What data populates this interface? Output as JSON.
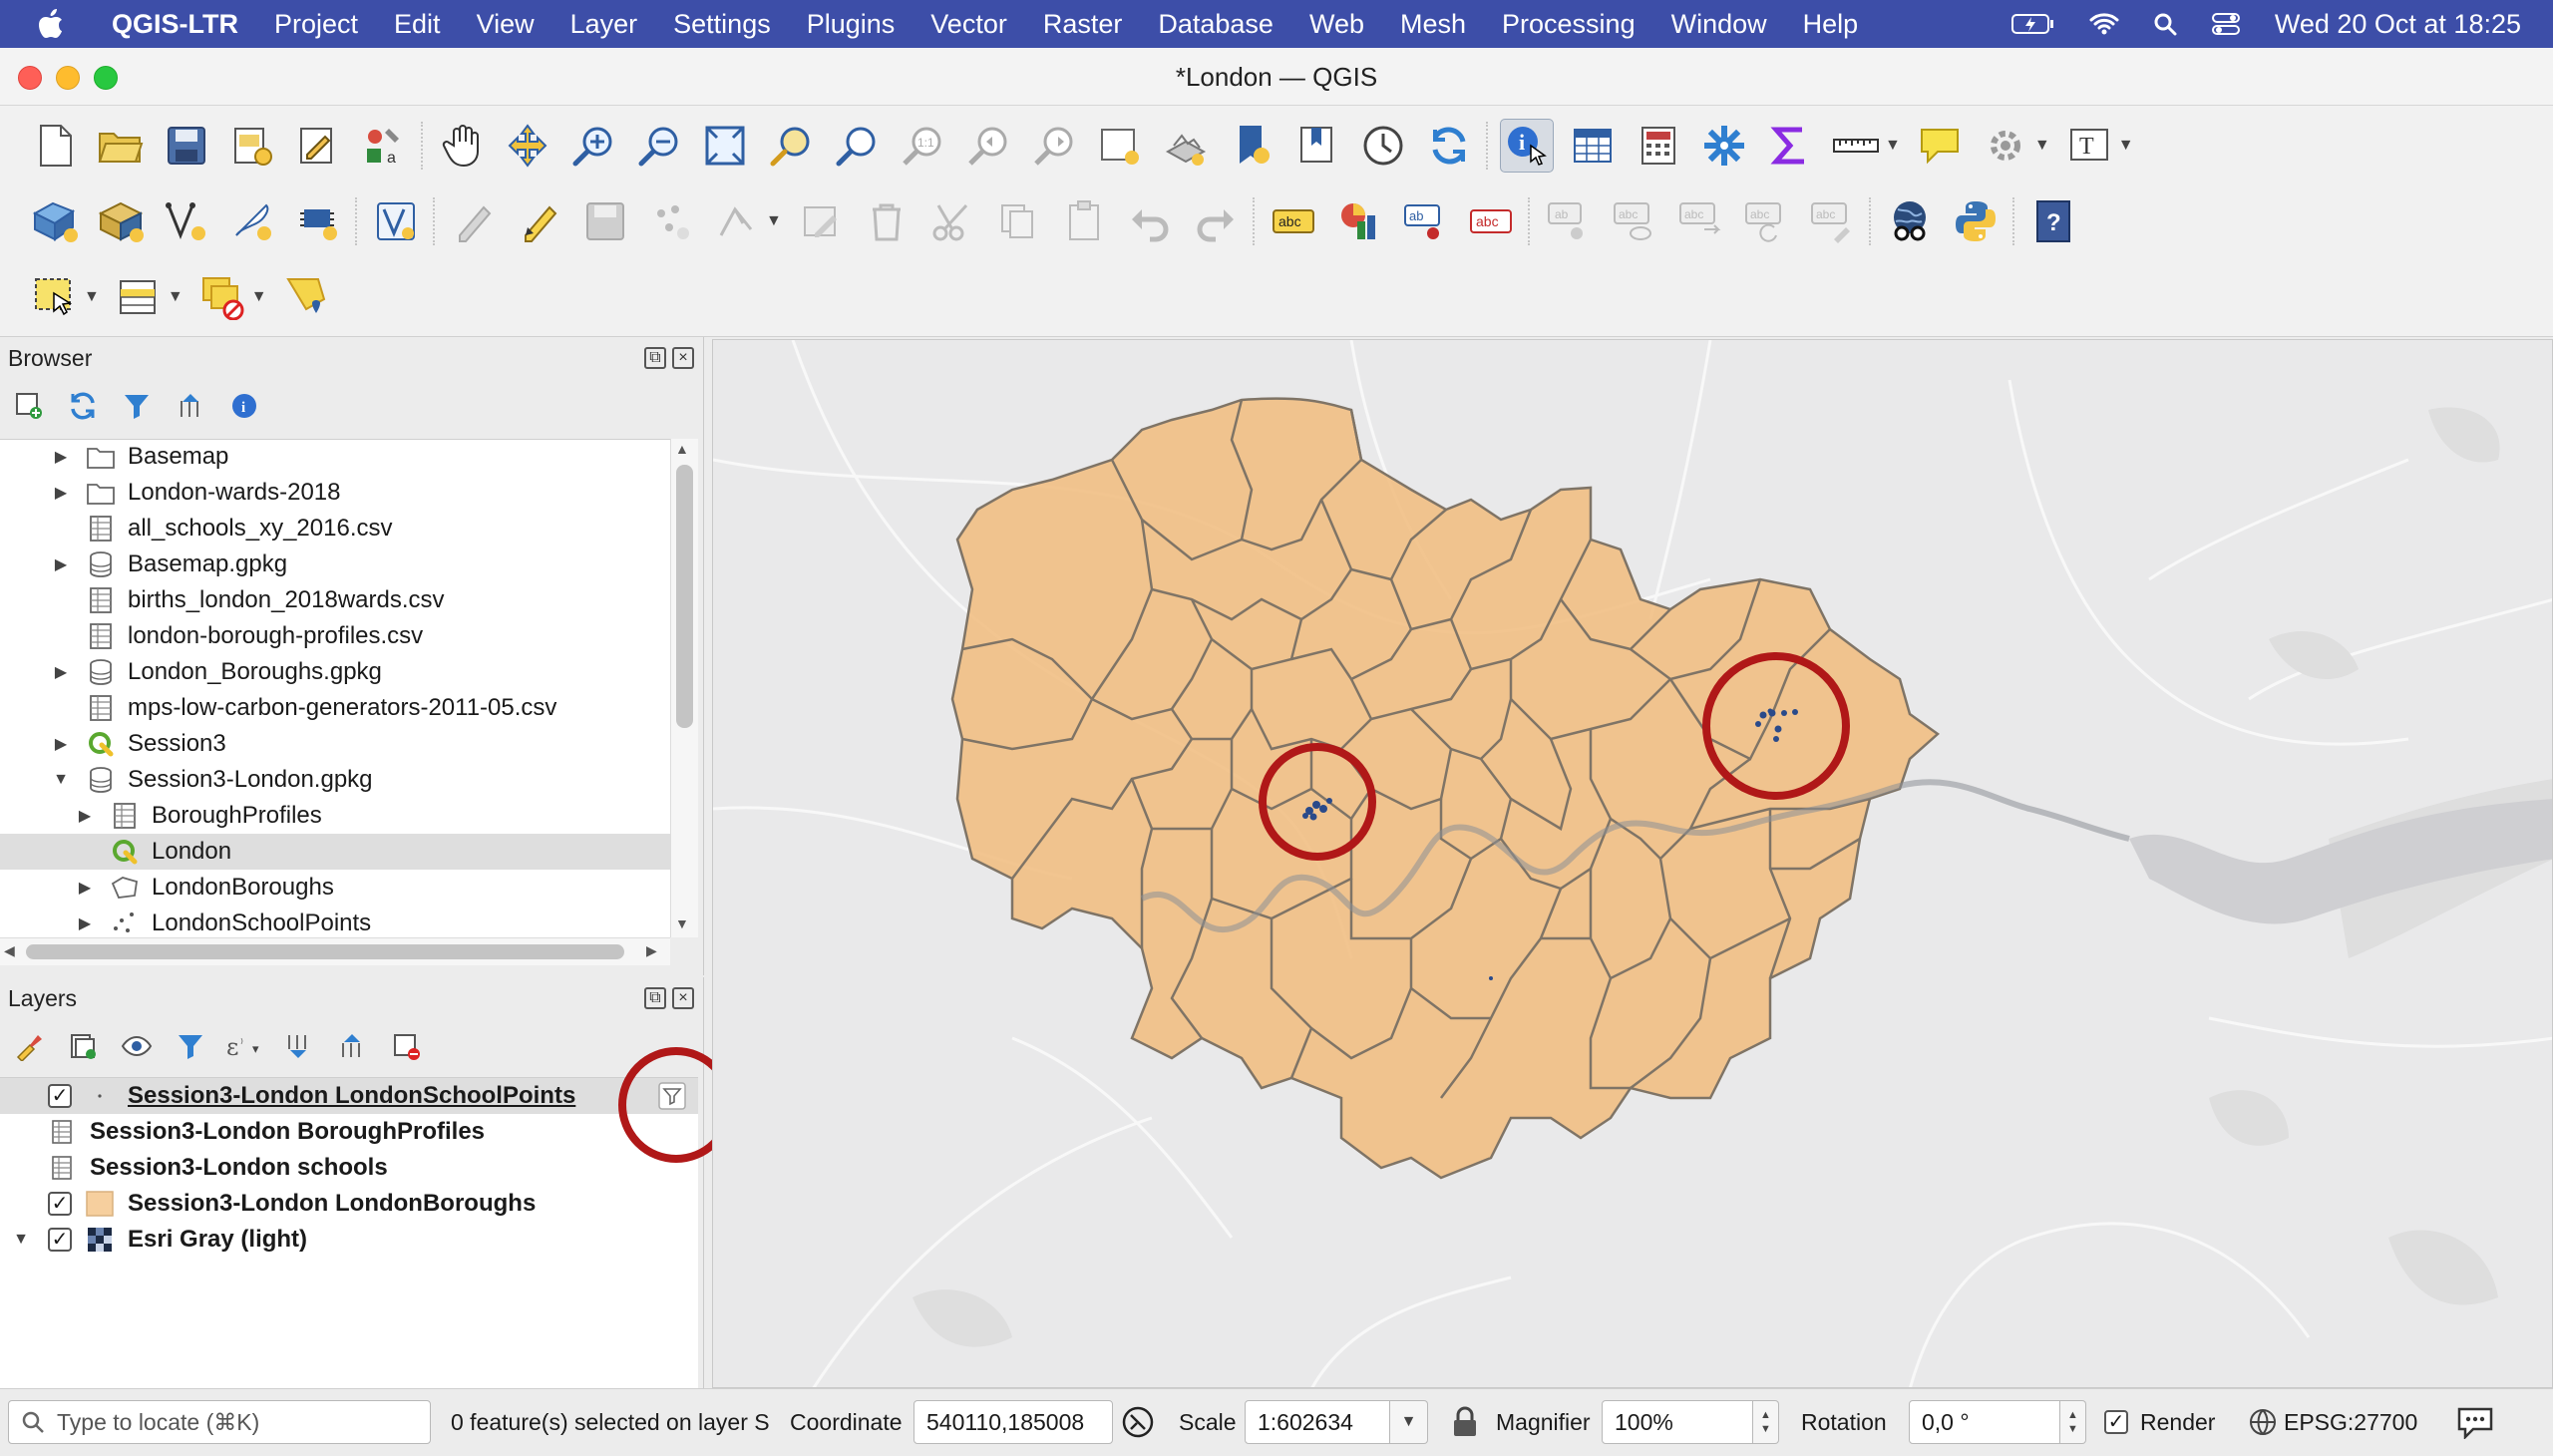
{
  "menubar": {
    "app": "QGIS-LTR",
    "items": [
      "Project",
      "Edit",
      "View",
      "Layer",
      "Settings",
      "Plugins",
      "Vector",
      "Raster",
      "Database",
      "Web",
      "Mesh",
      "Processing",
      "Window",
      "Help"
    ],
    "datetime": "Wed 20 Oct at  18:25"
  },
  "window": {
    "title": "*London — QGIS"
  },
  "browser": {
    "title": "Browser",
    "items": [
      {
        "label": "Basemap",
        "type": "folder",
        "expand": "collapsed",
        "indent": 0
      },
      {
        "label": "London-wards-2018",
        "type": "folder",
        "expand": "collapsed",
        "indent": 0
      },
      {
        "label": "all_schools_xy_2016.csv",
        "type": "table",
        "expand": "none",
        "indent": 0
      },
      {
        "label": "Basemap.gpkg",
        "type": "db",
        "expand": "collapsed",
        "indent": 0
      },
      {
        "label": "births_london_2018wards.csv",
        "type": "table",
        "expand": "none",
        "indent": 0
      },
      {
        "label": "london-borough-profiles.csv",
        "type": "table",
        "expand": "none",
        "indent": 0
      },
      {
        "label": "London_Boroughs.gpkg",
        "type": "db",
        "expand": "collapsed",
        "indent": 0
      },
      {
        "label": "mps-low-carbon-generators-2011-05.csv",
        "type": "table",
        "expand": "none",
        "indent": 0
      },
      {
        "label": "Session3",
        "type": "qgis",
        "expand": "collapsed",
        "indent": 0
      },
      {
        "label": "Session3-London.gpkg",
        "type": "db",
        "expand": "expanded",
        "indent": 0
      },
      {
        "label": "BoroughProfiles",
        "type": "table",
        "expand": "collapsed",
        "indent": 1
      },
      {
        "label": "London",
        "type": "qgis",
        "expand": "none",
        "indent": 1,
        "selected": true
      },
      {
        "label": "LondonBoroughs",
        "type": "polygon",
        "expand": "collapsed",
        "indent": 1
      },
      {
        "label": "LondonSchoolPoints",
        "type": "points",
        "expand": "collapsed",
        "indent": 1
      }
    ]
  },
  "layers": {
    "title": "Layers",
    "items": [
      {
        "label": "Session3-London LondonSchoolPoints",
        "checked": true,
        "icon": "point",
        "selected": true,
        "filter": true
      },
      {
        "label": "Session3-London BoroughProfiles",
        "checked": null,
        "icon": "table"
      },
      {
        "label": "Session3-London schools",
        "checked": null,
        "icon": "table"
      },
      {
        "label": "Session3-London LondonBoroughs",
        "checked": true,
        "icon": "polygon"
      },
      {
        "label": "Esri Gray (light)",
        "checked": true,
        "icon": "raster",
        "expanded": true
      }
    ]
  },
  "map": {
    "fill_color": "#f1bf84",
    "border_color": "#7f7466",
    "highlight_color": "#b01818",
    "point_color": "#2a4a8a"
  },
  "statusbar": {
    "locate_placeholder": "Type to locate (⌘K)",
    "selection_msg": "0 feature(s) selected on layer S",
    "coordinate_label": "Coordinate",
    "coordinate_value": "540110,185008",
    "scale_label": "Scale",
    "scale_value": "1:602634",
    "magnifier_label": "Magnifier",
    "magnifier_value": "100%",
    "rotation_label": "Rotation",
    "rotation_value": "0,0 °",
    "render_label": "Render",
    "render_checked": true,
    "crs": "EPSG:27700"
  }
}
